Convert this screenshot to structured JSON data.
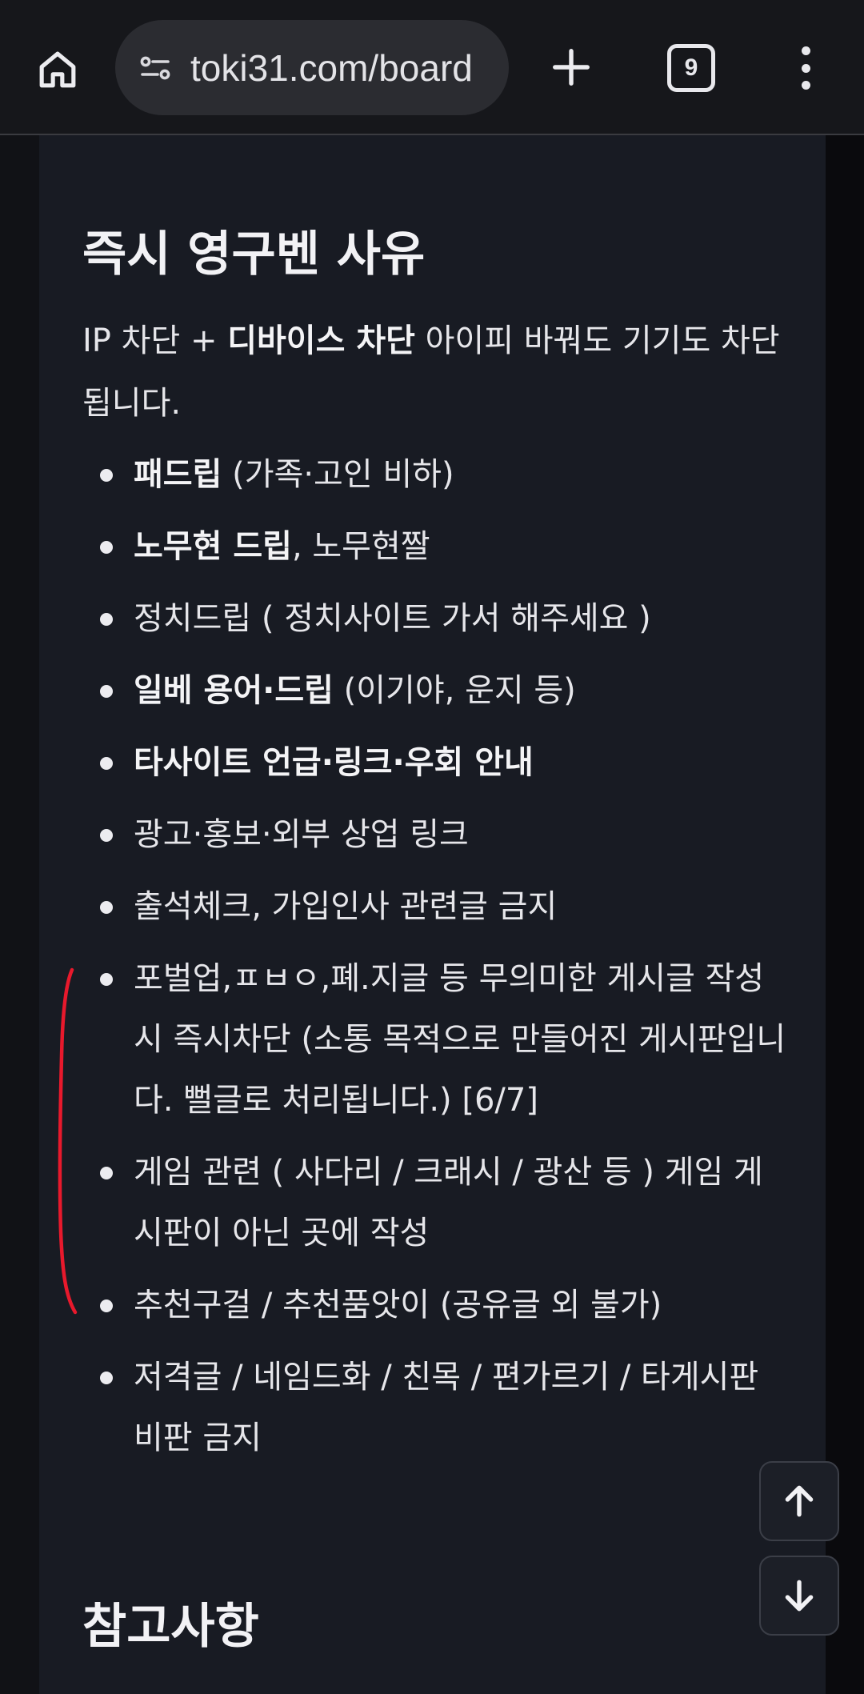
{
  "browser": {
    "url": "toki31.com/board",
    "tab_count": "9",
    "icons": [
      "home-icon",
      "site-info-icon",
      "plus-icon",
      "tab-switcher-icon",
      "more-vert-icon"
    ]
  },
  "content": {
    "title": "즉시 영구벤 사유",
    "intro": {
      "prefix": "IP 차단 + ",
      "bold": "디바이스 차단",
      "suffix": " 아이피 바꿔도 기기도 차단됩니다."
    },
    "rules": [
      {
        "bold": "패드립",
        "text": " (가족·고인 비하)"
      },
      {
        "bold": "노무현 드립",
        "text": ", 노무현짤"
      },
      {
        "bold": "",
        "text": "정치드립 ( 정치사이트 가서 해주세요 )"
      },
      {
        "bold": "일베 용어·드립",
        "text": " (이기야, 운지 등)"
      },
      {
        "bold": "타사이트 언급·링크·우회 안내",
        "text": ""
      },
      {
        "bold": "",
        "text": "광고·홍보·외부 상업 링크"
      },
      {
        "bold": "",
        "text": "출석체크, 가입인사 관련글 금지"
      },
      {
        "bold": "",
        "text": "포벌업,ㅍㅂㅇ,폐.지글 등 무의미한 게시글 작성시 즉시차단 (소통 목적으로 만들어진 게시판입니다. 뻘글로 처리됩니다.) [6/7]"
      },
      {
        "bold": "",
        "text": "게임 관련 ( 사다리 / 크래시 / 광산 등 ) 게임 게시판이 아닌 곳에 작성"
      },
      {
        "bold": "",
        "text": "추천구걸 / 추천품앗이 (공유글 외 불가)"
      },
      {
        "bold": "",
        "text": "저격글 / 네임드화 / 친목 / 편가르기 / 타게시판 비판 금지"
      }
    ],
    "notes_title": "참고사항"
  },
  "scroll_controls": {
    "up_icon": "arrow-up-icon",
    "down_icon": "arrow-down-icon"
  },
  "colors": {
    "page_bg": "#0c0d11",
    "card_bg": "#181b23",
    "text": "#e6e6ea",
    "annotation_red": "#e8192c"
  }
}
